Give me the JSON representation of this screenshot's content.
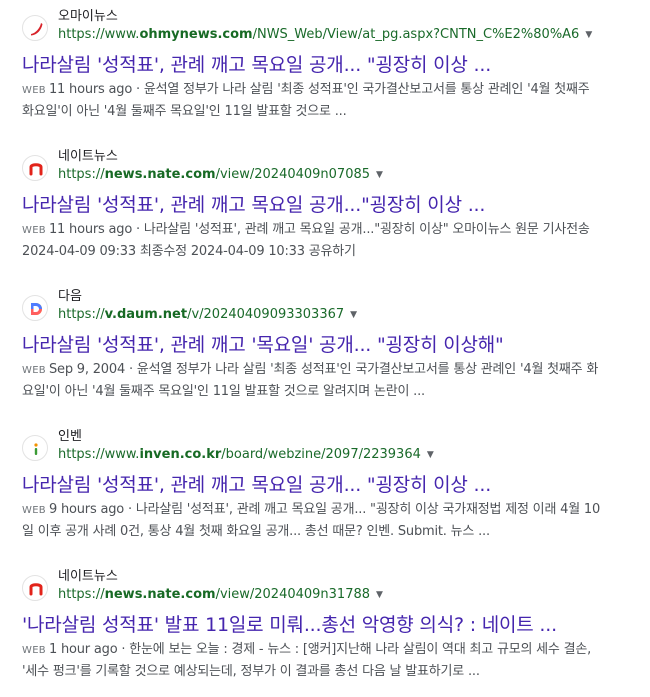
{
  "results": [
    {
      "site_name": "오마이뉴스",
      "url_prefix": "https://www.",
      "url_domain": "ohmynews.com",
      "url_path": "/NWS_Web/View/at_pg.aspx?CNTN_C%E2%80%A6",
      "title": "나라살림 '성적표', 관례 깨고 목요일 공개... \"굉장히 이상 ...",
      "tag": "WEB",
      "snippet_line1": "11 hours ago · 윤석열 정부가 나라 살림 '최종 성적표'인 국가결산보고서를 통상 관례인 '4월 첫째주",
      "snippet_line2": "화요일'이 아닌 '4월 둘째주 목요일'인 11일 발표할 것으로 ..."
    },
    {
      "site_name": "네이트뉴스",
      "url_prefix": "https://",
      "url_domain": "news.nate.com",
      "url_path": "/view/20240409n07085",
      "title": "나라살림 '성적표', 관례 깨고 목요일 공개...\"굉장히 이상 ...",
      "tag": "WEB",
      "snippet_line1": "11 hours ago · 나라살림 '성적표', 관례 깨고 목요일 공개...\"굉장히 이상\" 오마이뉴스 원문 기사전송",
      "snippet_line2": "2024-04-09 09:33 최종수정 2024-04-09 10:33 공유하기"
    },
    {
      "site_name": "다음",
      "url_prefix": "https://",
      "url_domain": "v.daum.net",
      "url_path": "/v/20240409093303367",
      "title": "나라살림 '성적표', 관례 깨고 '목요일' 공개... \"굉장히 이상해\"",
      "tag": "WEB",
      "snippet_line1": "Sep 9, 2004 · 윤석열 정부가 나라 살림 '최종 성적표'인 국가결산보고서를 통상 관례인 '4월 첫째주 화",
      "snippet_line2": "요일'이 아닌 '4월 둘째주 목요일'인 11일 발표할 것으로 알려지며 논란이 ..."
    },
    {
      "site_name": "인벤",
      "url_prefix": "https://www.",
      "url_domain": "inven.co.kr",
      "url_path": "/board/webzine/2097/2239364",
      "title": "나라살림 '성적표', 관례 깨고 목요일 공개... \"굉장히 이상 ...",
      "tag": "WEB",
      "snippet_line1": "9 hours ago · 나라살림 '성적표', 관례 깨고 목요일 공개... \"굉장히 이상 국가재정법 제정 이래 4월 10",
      "snippet_line2": "일 이후 공개 사례 0건, 통상 4월 첫째 화요일 공개... 총선 때문? 인벤. Submit. 뉴스 ..."
    },
    {
      "site_name": "네이트뉴스",
      "url_prefix": "https://",
      "url_domain": "news.nate.com",
      "url_path": "/view/20240409n31788",
      "title": "'나라살림 성적표' 발표 11일로 미뤄...총선 악영향 의식? : 네이트 ...",
      "tag": "WEB",
      "snippet_line1": "1 hour ago · 한눈에 보는 오늘 : 경제 - 뉴스 : [앵커]지난해 나라 살림이 역대 최고 규모의 세수 결손,",
      "snippet_line2": "'세수 펑크'를 기록할 것으로 예상되는데, 정부가 이 결과를 총선 다음 날 발표하기로 ..."
    }
  ]
}
